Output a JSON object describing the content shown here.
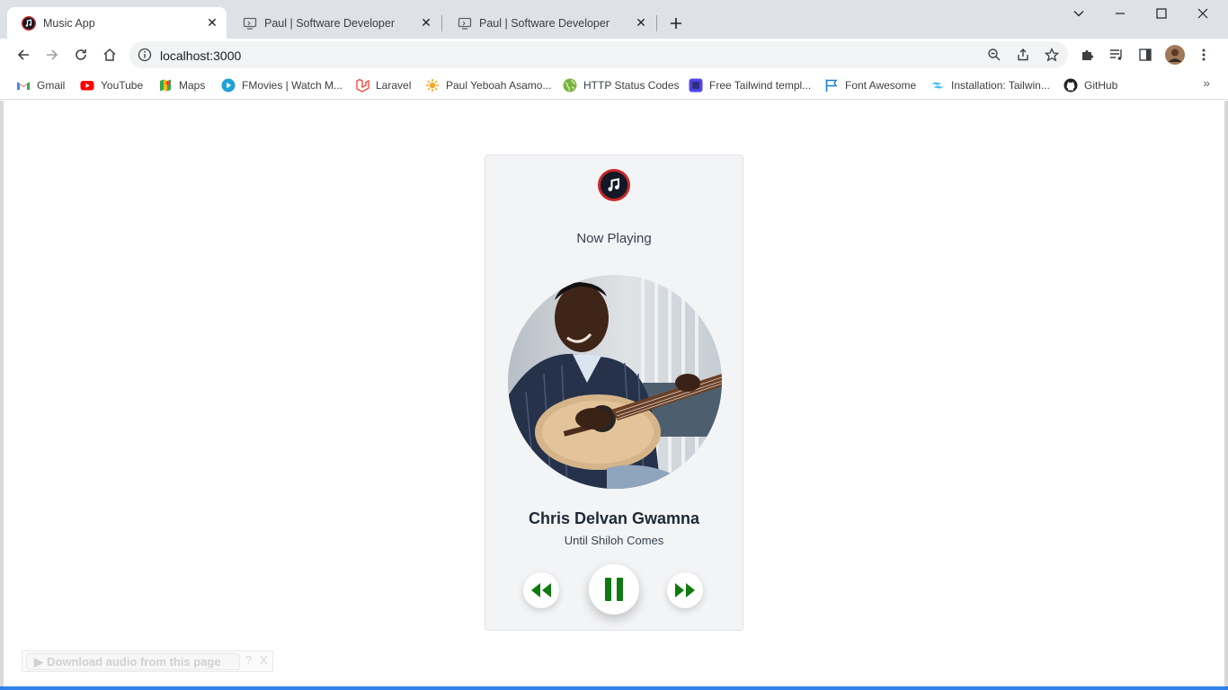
{
  "browser": {
    "tabs": [
      {
        "title": "Music App",
        "active": true
      },
      {
        "title": "Paul | Software Developer",
        "active": false
      },
      {
        "title": "Paul | Software Developer",
        "active": false
      }
    ],
    "address": {
      "url": "localhost:3000"
    },
    "bookmarks": [
      {
        "label": "Gmail",
        "icon": "gmail-icon"
      },
      {
        "label": "YouTube",
        "icon": "youtube-icon"
      },
      {
        "label": "Maps",
        "icon": "maps-icon"
      },
      {
        "label": "FMovies | Watch M...",
        "icon": "fmovies-icon"
      },
      {
        "label": "Laravel",
        "icon": "laravel-icon"
      },
      {
        "label": "Paul Yeboah Asamo...",
        "icon": "site-icon"
      },
      {
        "label": "HTTP Status Codes",
        "icon": "globe-icon"
      },
      {
        "label": "Free Tailwind templ...",
        "icon": "template-icon"
      },
      {
        "label": "Font Awesome",
        "icon": "flag-icon"
      },
      {
        "label": "Installation: Tailwin...",
        "icon": "tailwind-icon"
      },
      {
        "label": "GitHub",
        "icon": "github-icon"
      }
    ]
  },
  "player": {
    "heading": "Now Playing",
    "artist": "Chris Delvan Gwamna",
    "song": "Until Shiloh Comes",
    "accent_color": "#0f7a0f",
    "logo_color": "#c62828"
  },
  "extension": {
    "download_label": "Download audio from this page",
    "help": "?",
    "close": "X"
  }
}
